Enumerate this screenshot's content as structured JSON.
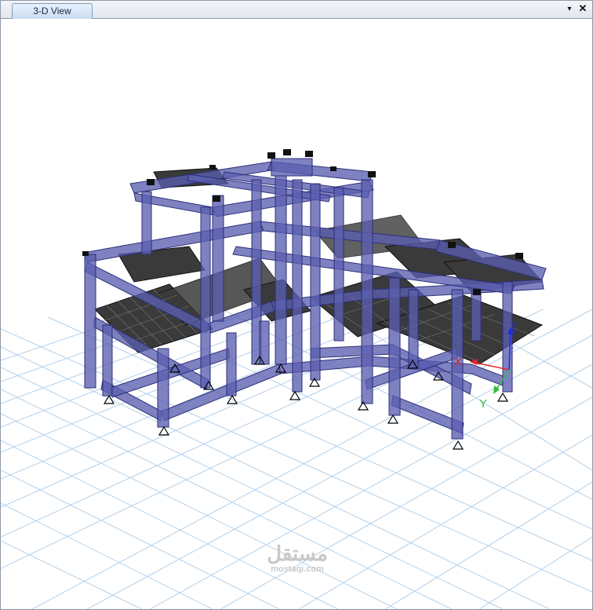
{
  "window": {
    "tab_label": "3-D View",
    "tab_menu_glyph": "▾",
    "close_glyph": "✕"
  },
  "axes": {
    "x_label": "X",
    "y_label": "Y",
    "z_label": "Z",
    "x_color": "#e0262a",
    "y_color": "#2fbf3a",
    "z_color": "#1f2fd6"
  },
  "colors": {
    "frame": "#5b5fb0",
    "frame_edge": "#2c2f78",
    "slab": "#3a3a3a",
    "grid": "#a9cbe9",
    "support": "#000000"
  },
  "watermark": {
    "main": "مستقل",
    "sub": "mostaqi.com"
  }
}
